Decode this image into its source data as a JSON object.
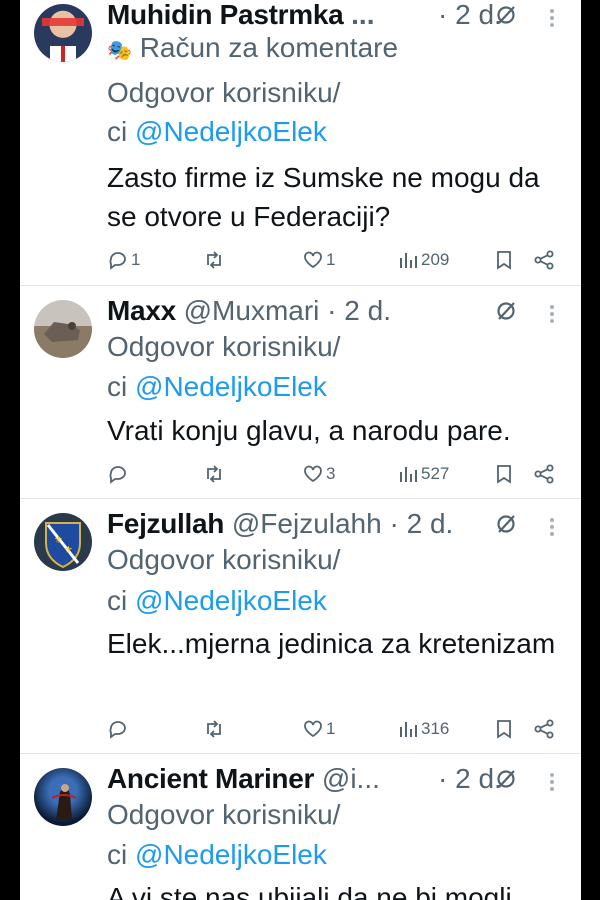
{
  "tweets": [
    {
      "name": "Muhidin Pastrmka",
      "handle": "...",
      "time": "2 d.",
      "community": "Račun za komentare",
      "reply_prefix": "Odgovor korisniku/",
      "reply_ci": "ci",
      "reply_mention": "@NedeljkoElek",
      "text": "Zasto firme iz Sumske ne mogu da se otvore u Federaciji?",
      "replies": "1",
      "retweets": "",
      "likes": "1",
      "views": "209"
    },
    {
      "name": "Maxx",
      "handle": "@Muxmari",
      "time": "2 d.",
      "reply_prefix": "Odgovor korisniku/",
      "reply_ci": "ci",
      "reply_mention": "@NedeljkoElek",
      "text": "Vrati konju glavu, a narodu pare.",
      "replies": "",
      "retweets": "",
      "likes": "3",
      "views": "527"
    },
    {
      "name": "Fejzullah",
      "handle": "@Fejzulahh",
      "time": "2 d.",
      "reply_prefix": "Odgovor korisniku/",
      "reply_ci": "ci",
      "reply_mention": "@NedeljkoElek",
      "text": "Elek...mjerna jedinica za kretenizam",
      "replies": "",
      "retweets": "",
      "likes": "1",
      "views": "316"
    },
    {
      "name": "Ancient Mariner",
      "handle": "@i...",
      "time": "2 d.",
      "reply_prefix": "Odgovor korisniku/",
      "reply_ci": "ci",
      "reply_mention": "@NedeljkoElek",
      "text": "A vi ste nas ubijali da ne bi mogli"
    }
  ],
  "icons": {
    "reply": "reply-icon",
    "retweet": "retweet-icon",
    "like": "heart-icon",
    "views": "views-icon",
    "bookmark": "bookmark-icon",
    "share": "share-icon",
    "grok": "grok-icon",
    "more": "more-icon"
  },
  "colors": {
    "mention": "#1d9bf0",
    "muted": "#536471",
    "text": "#0f1419"
  }
}
